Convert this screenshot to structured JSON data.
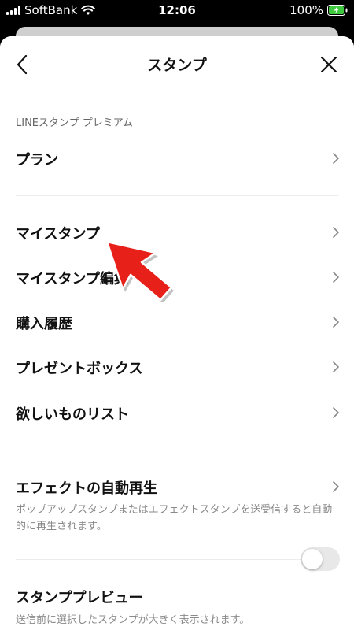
{
  "status_bar": {
    "carrier": "SoftBank",
    "time": "12:06",
    "battery": "100%"
  },
  "nav": {
    "title": "スタンプ",
    "back_icon": "chevron-left-icon",
    "close_icon": "close-icon"
  },
  "section": {
    "premium_label": "LINEスタンプ プレミアム"
  },
  "menu": {
    "plan": "プラン",
    "my_stamps": "マイスタンプ",
    "my_stamps_edit": "マイスタンプ編集",
    "purchase_history": "購入履歴",
    "present_box": "プレゼントボックス",
    "wishlist": "欲しいものリスト"
  },
  "effect": {
    "label": "エフェクトの自動再生",
    "description": "ポップアップスタンプまたはエフェクトスタンプを送受信すると自動的に再生されます。"
  },
  "preview": {
    "label": "スタンププレビュー",
    "description": "送信前に選択したスタンプが大きく表示されます。",
    "enabled": false
  },
  "colors": {
    "annotation_arrow": "#e8201a",
    "toggle_off": "#e8e8e8",
    "battery_charging": "#3ec93e"
  }
}
